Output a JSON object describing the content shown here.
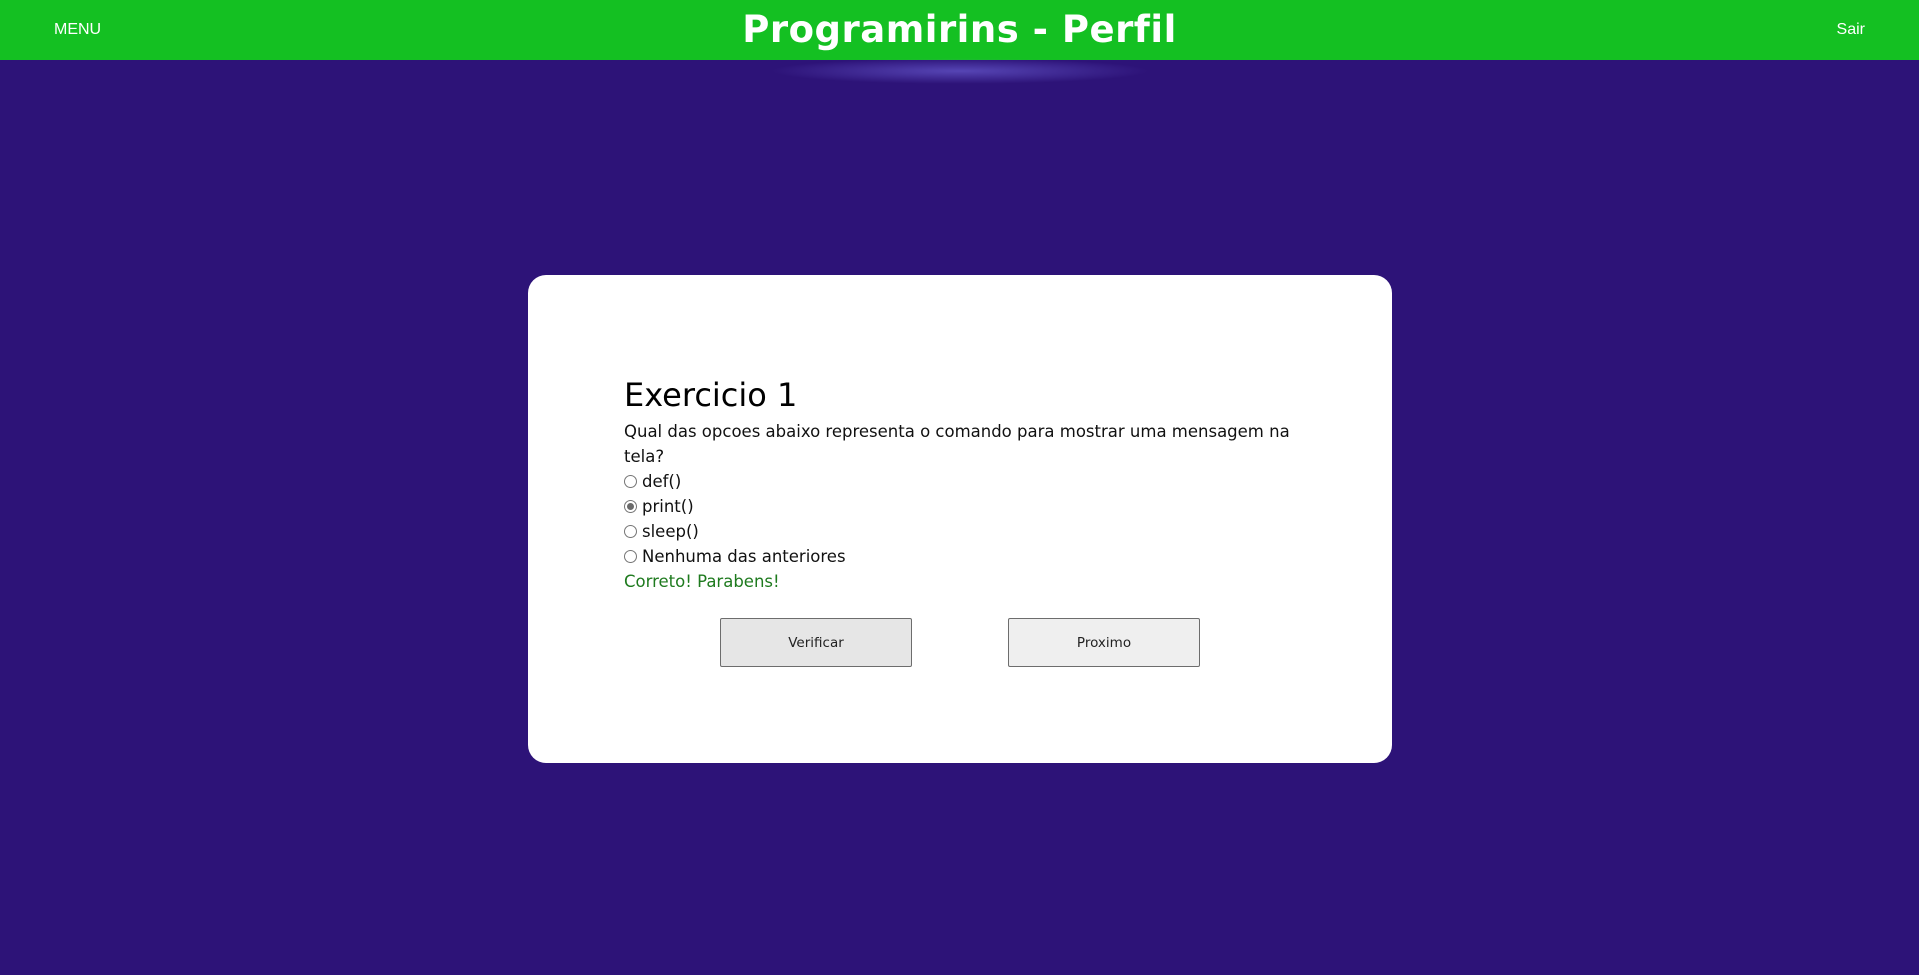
{
  "header": {
    "menu_label": "MENU",
    "title": "Programirins - Perfil",
    "logout_label": "Sair"
  },
  "exercise": {
    "title": "Exercicio 1",
    "question": "Qual das opcoes abaixo representa o comando para mostrar uma mensagem na tela?",
    "options": [
      {
        "label": "def()",
        "selected": false
      },
      {
        "label": "print()",
        "selected": true
      },
      {
        "label": "sleep()",
        "selected": false
      },
      {
        "label": "Nenhuma das anteriores",
        "selected": false
      }
    ],
    "feedback": "Correto! Parabens!",
    "verify_label": "Verificar",
    "next_label": "Proximo"
  },
  "colors": {
    "background": "#2d1378",
    "header": "#14c022",
    "card": "#ffffff",
    "feedback_success": "#1e7a1e"
  }
}
